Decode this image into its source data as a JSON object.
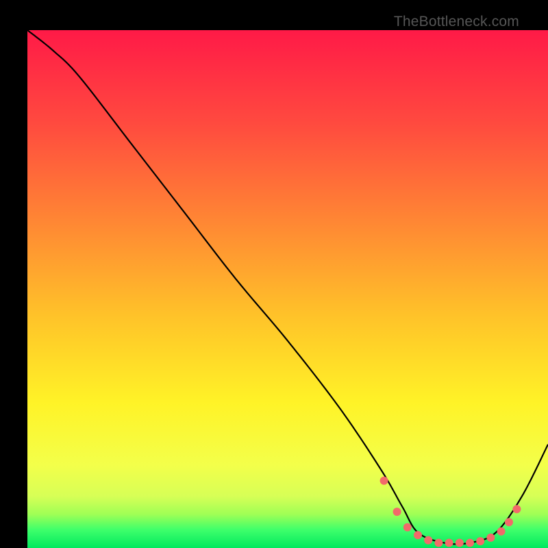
{
  "attribution": "TheBottleneck.com",
  "chart_data": {
    "type": "line",
    "title": "",
    "xlabel": "",
    "ylabel": "",
    "xlim": [
      0,
      100
    ],
    "ylim": [
      0,
      100
    ],
    "series": [
      {
        "name": "curve",
        "x": [
          0,
          5,
          10,
          20,
          30,
          40,
          50,
          60,
          68,
          72,
          75,
          80,
          85,
          90,
          95,
          100
        ],
        "y": [
          100,
          96,
          91,
          78,
          65,
          52,
          40,
          27,
          15,
          8,
          3,
          1,
          1,
          3,
          10,
          20
        ]
      }
    ],
    "markers": {
      "name": "flat-region-dots",
      "x": [
        68.5,
        71,
        73,
        75,
        77,
        79,
        81,
        83,
        85,
        87,
        89,
        91,
        92.5,
        94
      ],
      "y": [
        13,
        7,
        4,
        2.5,
        1.5,
        1,
        1,
        1,
        1,
        1.3,
        2,
        3.2,
        5,
        7.5
      ]
    },
    "gradient_stops": [
      {
        "offset": 0.0,
        "color": "#ff1a47"
      },
      {
        "offset": 0.18,
        "color": "#ff4a3f"
      },
      {
        "offset": 0.38,
        "color": "#ff8a33"
      },
      {
        "offset": 0.55,
        "color": "#ffc229"
      },
      {
        "offset": 0.72,
        "color": "#fff327"
      },
      {
        "offset": 0.84,
        "color": "#f3ff4a"
      },
      {
        "offset": 0.9,
        "color": "#d7ff56"
      },
      {
        "offset": 0.935,
        "color": "#9fff55"
      },
      {
        "offset": 0.965,
        "color": "#3eff6b"
      },
      {
        "offset": 1.0,
        "color": "#00e85e"
      }
    ],
    "marker_color": "#f26a6a",
    "line_color": "#000000"
  }
}
